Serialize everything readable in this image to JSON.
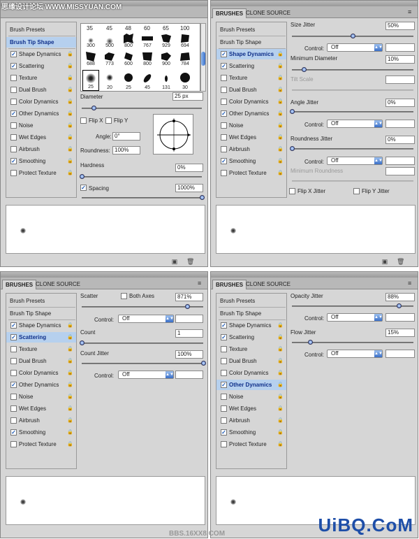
{
  "watermark": "思缘设计论坛 WWW.MISSYUAN.COM",
  "site_logo": "UiBQ.CoM",
  "bbs_mark": "BBS.16XX8.COM",
  "tabs": {
    "brushes": "BRUSHES",
    "clone_source": "CLONE SOURCE"
  },
  "list": {
    "presets": "Brush Presets",
    "tip_shape": "Brush Tip Shape",
    "items": [
      "Shape Dynamics",
      "Scattering",
      "Texture",
      "Dual Brush",
      "Color Dynamics",
      "Other Dynamics",
      "Noise",
      "Wet Edges",
      "Airbrush",
      "Smoothing",
      "Protect Texture"
    ],
    "checked": [
      true,
      true,
      false,
      false,
      false,
      true,
      false,
      false,
      false,
      true,
      false
    ]
  },
  "brush_grid": {
    "top_row": [
      "35",
      "45",
      "48",
      "60",
      "65",
      "100"
    ],
    "row2": [
      "300",
      "500",
      "800",
      "767",
      "929",
      "694"
    ],
    "row3": [
      "688",
      "773",
      "600",
      "800",
      "900",
      "784"
    ],
    "row4": [
      "25",
      "20",
      "25",
      "45",
      "131",
      "30"
    ]
  },
  "tip": {
    "diameter_label": "Diameter",
    "diameter_value": "25 px",
    "flipx": "Flip X",
    "flipy": "Flip Y",
    "angle_label": "Angle:",
    "angle_value": "0°",
    "roundness_label": "Roundness:",
    "roundness_value": "100%",
    "hardness_label": "Hardness",
    "hardness_value": "0%",
    "spacing_label": "Spacing",
    "spacing_value": "1000%",
    "diameter_pos": 0.1,
    "hardness_pos": 0.0,
    "spacing_pos": 1.0
  },
  "shape": {
    "size_jitter_label": "Size Jitter",
    "size_jitter_value": "50%",
    "size_jitter_pos": 0.5,
    "control_label": "Control:",
    "off": "Off",
    "min_diam_label": "Minimum Diameter",
    "min_diam_value": "10%",
    "min_diam_pos": 0.1,
    "tilt_label": "Tilt Scale",
    "angle_jitter_label": "Angle Jitter",
    "angle_jitter_value": "0%",
    "roundness_jitter_label": "Roundness Jitter",
    "roundness_jitter_value": "0%",
    "min_roundness_label": "Minimum Roundness",
    "flipx_jitter": "Flip X Jitter",
    "flipy_jitter": "Flip Y Jitter"
  },
  "scatter": {
    "scatter_label": "Scatter",
    "both_axes": "Both Axes",
    "scatter_value": "871%",
    "scatter_pos": 0.87,
    "control_label": "Control:",
    "off": "Off",
    "count_label": "Count",
    "count_value": "1",
    "count_pos": 0.0,
    "count_jitter_label": "Count Jitter",
    "count_jitter_value": "100%",
    "count_jitter_pos": 1.0
  },
  "other": {
    "opacity_label": "Opacity Jitter",
    "opacity_value": "88%",
    "opacity_pos": 0.88,
    "control_label": "Control:",
    "off": "Off",
    "flow_label": "Flow Jitter",
    "flow_value": "15%",
    "flow_pos": 0.15
  },
  "icons": {
    "menu": "panel-menu-icon",
    "new": "new-brush-icon",
    "trash": "trash-icon",
    "lock": "lock-icon"
  }
}
